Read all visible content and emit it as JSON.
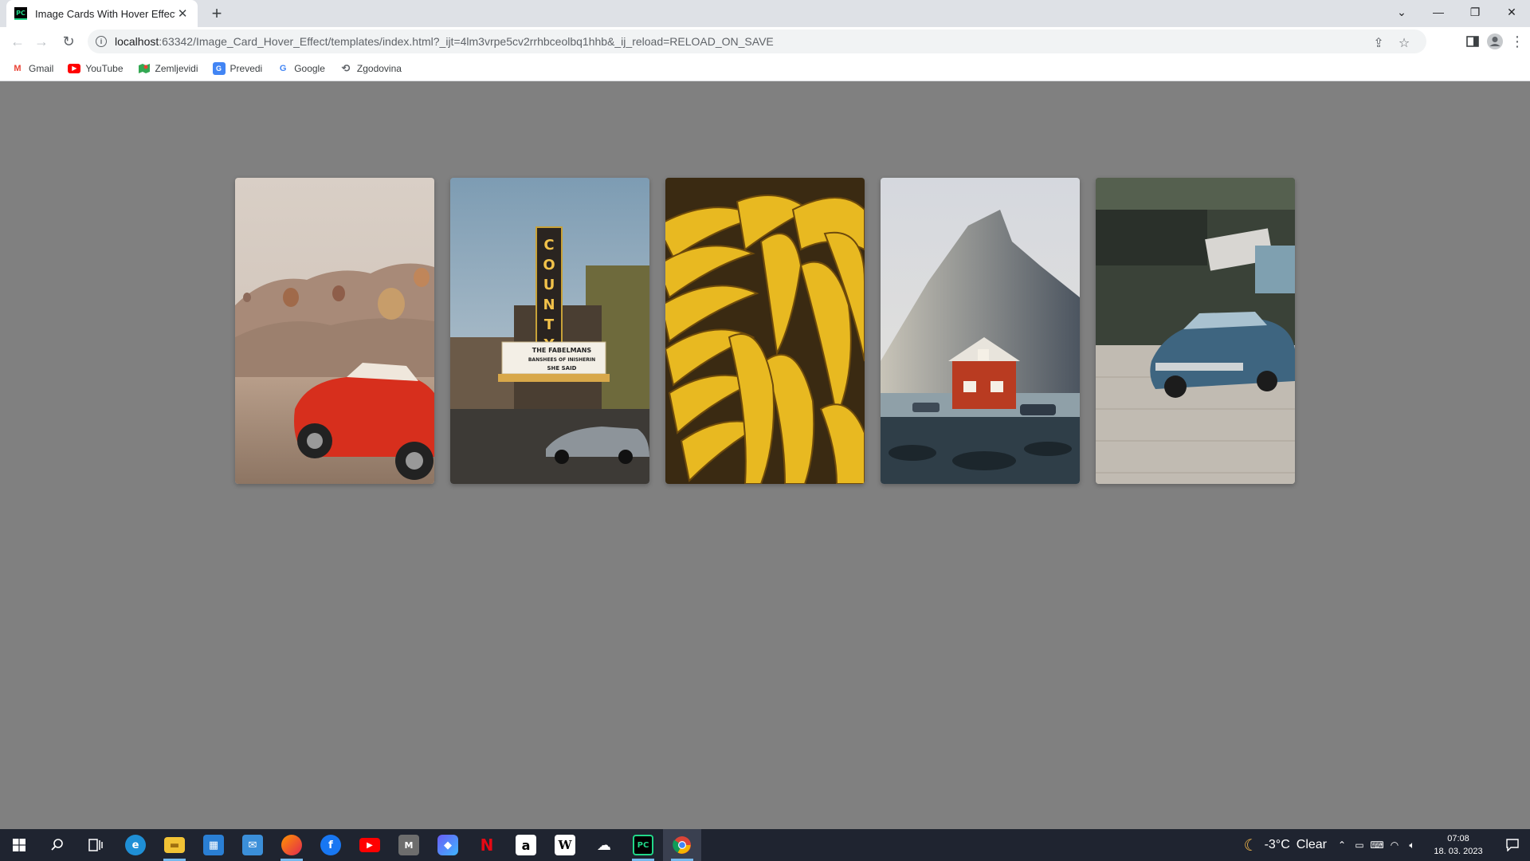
{
  "browser": {
    "tab_title": "Image Cards With Hover Effect",
    "tab_favicon_text": "PC",
    "url_host": "localhost",
    "url_path": ":63342/Image_Card_Hover_Effect/templates/index.html?_ijt=4lm3vrpe5cv2rrhbceolbq1hhb&_ij_reload=RELOAD_ON_SAVE",
    "bookmarks": [
      {
        "label": "Gmail",
        "icon": "gmail-icon"
      },
      {
        "label": "YouTube",
        "icon": "youtube-icon"
      },
      {
        "label": "Zemljevidi",
        "icon": "maps-icon"
      },
      {
        "label": "Prevedi",
        "icon": "translate-icon"
      },
      {
        "label": "Google",
        "icon": "google-icon"
      },
      {
        "label": "Zgodovina",
        "icon": "history-icon"
      }
    ]
  },
  "cards": [
    {
      "subject": "red convertible in Cappadocia with hot air balloons",
      "icon": "photo-red-car"
    },
    {
      "subject": "County theater marquee at dusk",
      "icon": "photo-theater"
    },
    {
      "subject": "bunch of bananas",
      "icon": "photo-bananas"
    },
    {
      "subject": "red cabin beneath a mountain",
      "icon": "photo-red-house"
    },
    {
      "subject": "blue vintage car on cobblestone street",
      "icon": "photo-blue-car"
    }
  ],
  "theater": {
    "sign": "COUNTY",
    "marquee_lines": [
      "THE FABELMANS",
      "BANSHEES OF INISHERIN",
      "SHE SAID"
    ]
  },
  "taskbar": {
    "weather_temp": "-3°C",
    "weather_text": "Clear",
    "time": "07:08",
    "date": "18. 03. 2023"
  },
  "colors": {
    "page_background": "#808080",
    "taskbar": "#1f2430",
    "accent": "#76b9ed"
  }
}
